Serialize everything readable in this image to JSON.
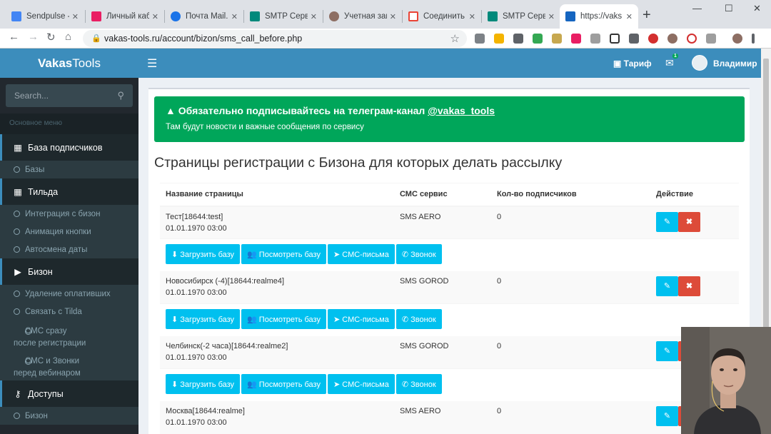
{
  "browser": {
    "tabs": [
      {
        "title": "Sendpulse -",
        "color": "#4285f4"
      },
      {
        "title": "Личный каб",
        "color": "#e91e63"
      },
      {
        "title": "Почта Mail.",
        "color": "#1a73e8"
      },
      {
        "title": "SMTP Серв",
        "color": "#00897b"
      },
      {
        "title": "Учетная зап",
        "color": "#8d6e63"
      },
      {
        "title": "Соединить",
        "color": "#ea4335"
      },
      {
        "title": "SMTP Серв",
        "color": "#00897b"
      },
      {
        "title": "https://vaks",
        "color": "#1565c0"
      }
    ],
    "url": "vakas-tools.ru/account/bizon/sms_call_before.php"
  },
  "app": {
    "brand_bold": "Vakas",
    "brand_light": "Tools",
    "search_placeholder": "Search...",
    "menu_header": "Основное меню",
    "menu": {
      "m1": "База подписчиков",
      "m1_s1": "Базы",
      "m2": "Тильда",
      "m2_s1": "Интеграция с бизон",
      "m2_s2": "Анимация кнопки",
      "m2_s3": "Автосмена даты",
      "m3": "Бизон",
      "m3_s1": "Удаление оплативших",
      "m3_s2": "Связать с Tilda",
      "m3_s3_l1": "СМС сразу",
      "m3_s3_l2": "после регистрации",
      "m3_s4_l1": "СМС и Звонки",
      "m3_s4_l2": "перед вебинаром",
      "m4": "Доступы",
      "m4_s1": "Бизон"
    },
    "header": {
      "tariff": "Тариф",
      "mail_count": "1",
      "user": "Владимир"
    }
  },
  "alert": {
    "title": "Обязательно подписывайтесь на телеграм-канал ",
    "link": "@vakas_tools",
    "subtitle": "Там будут новости и важные сообщения по сервису"
  },
  "page_title": "Страницы регистрации с Бизона для которых делать рассылку",
  "table": {
    "headers": [
      "Название страницы",
      "СМС сервис",
      "Кол-во подписчиков",
      "Действие"
    ],
    "rows": [
      {
        "name": "Тест[18644:test]",
        "date": "01.01.1970 03:00",
        "service": "SMS AERO",
        "count": "0"
      },
      {
        "name": "Новосибирск (-4)[18644:realme4]",
        "date": "01.01.1970 03:00",
        "service": "SMS GOROD",
        "count": "0"
      },
      {
        "name": "Челбинск(-2 часа)[18644:realme2]",
        "date": "01.01.1970 03:00",
        "service": "SMS GOROD",
        "count": "0"
      },
      {
        "name": "Москва[18644:realme]",
        "date": "01.01.1970 03:00",
        "service": "SMS AERO",
        "count": "0"
      }
    ],
    "buttons": {
      "load": "Загрузить базу",
      "view": "Посмотреть базу",
      "sms": "СМС-письма",
      "call": "Звонок"
    }
  }
}
